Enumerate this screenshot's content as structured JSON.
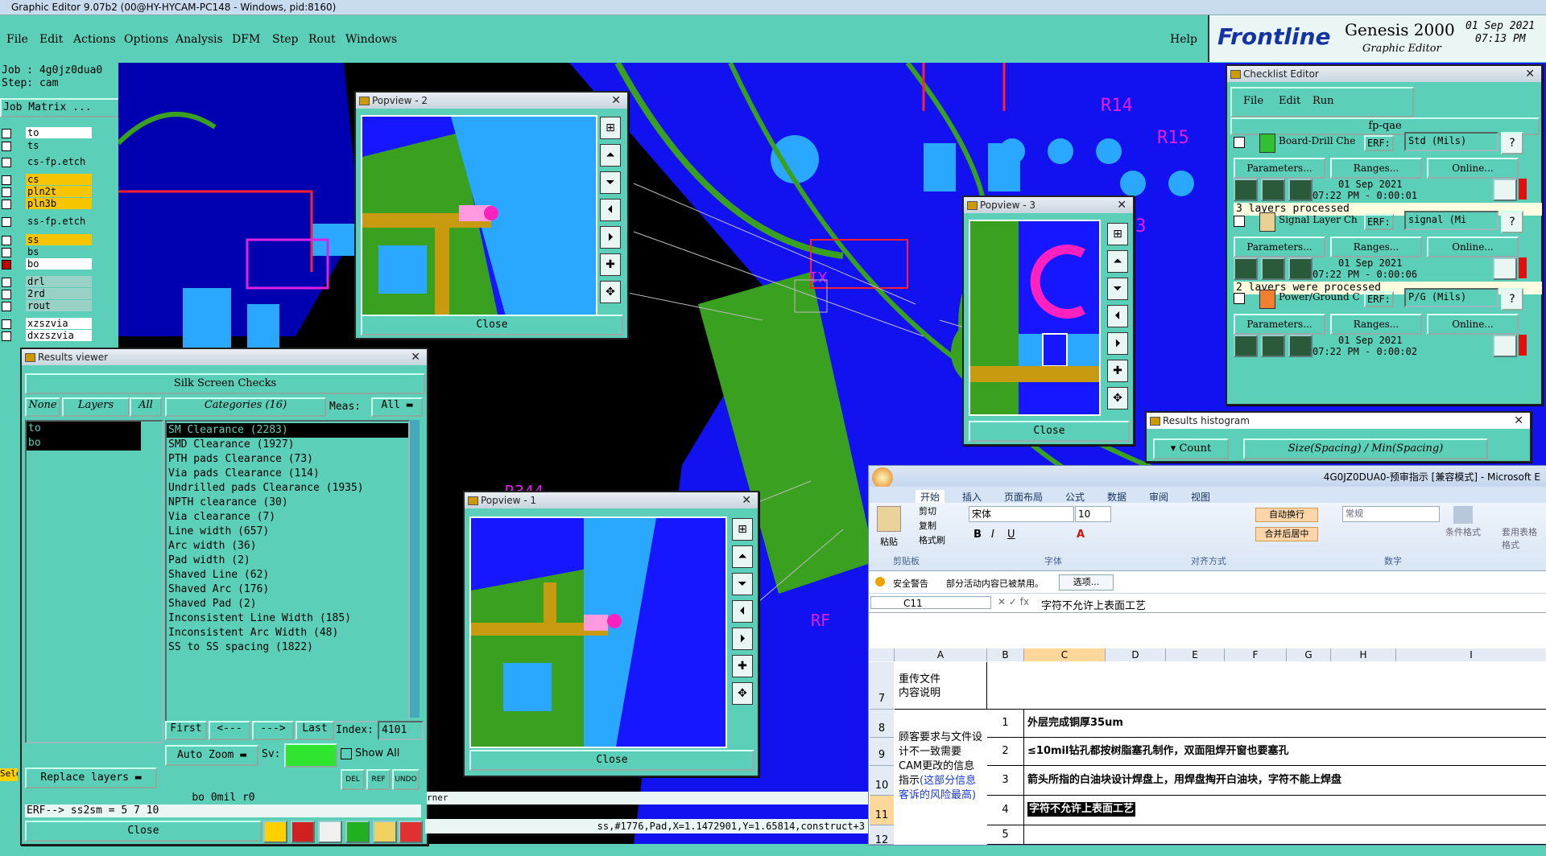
{
  "window": {
    "title": "Graphic Editor 9.07b2 (00@HY-HYCAM-PC148 - Windows, pid:8160)"
  },
  "menu": [
    "File",
    "Edit",
    "Actions",
    "Options",
    "Analysis",
    "DFM",
    "Step",
    "Rout",
    "Windows"
  ],
  "help_label": "Help",
  "brand": {
    "name": "Frontline",
    "product": "Genesis 2000",
    "subtitle": "Graphic Editor",
    "date": "01 Sep 2021",
    "time": "07:13 PM"
  },
  "job": {
    "job_label": "Job : 4g0jz0dua0",
    "step_label": "Step: cam",
    "matrix_button": "Job Matrix ..."
  },
  "layers": [
    {
      "name": "to",
      "color": "#ffffff"
    },
    {
      "name": "ts",
      "color": "#5ccfb8"
    },
    {
      "name": "cs-fp.etch",
      "color": "#5ccfb8"
    },
    {
      "name": "cs",
      "color": "#f7c400"
    },
    {
      "name": "pln2t",
      "color": "#f7c400"
    },
    {
      "name": "pln3b",
      "color": "#f7c400"
    },
    {
      "name": "ss-fp.etch",
      "color": "#5ccfb8"
    },
    {
      "name": "ss",
      "color": "#f7c400"
    },
    {
      "name": "bs",
      "color": "#5ccfb8"
    },
    {
      "name": "bo",
      "color": "#ffffff"
    },
    {
      "name": "drl",
      "color": "#9ad1c6"
    },
    {
      "name": "2rd",
      "color": "#9ad1c6"
    },
    {
      "name": "rout",
      "color": "#9ad1c6"
    },
    {
      "name": "xzszvia",
      "color": "#ffffff"
    },
    {
      "name": "dxzszvia",
      "color": "#ffffff"
    }
  ],
  "popview1": {
    "title": "Popview - 1",
    "close": "Close"
  },
  "popview2": {
    "title": "Popview - 2",
    "close": "Close"
  },
  "popview3": {
    "title": "Popview - 3",
    "close": "Close"
  },
  "results": {
    "title": "Results viewer",
    "heading": "Silk Screen Checks",
    "none_btn": "None",
    "layers_btn": "Layers",
    "all_btn": "All",
    "categories_label": "Categories (16)",
    "meas_label": "Meas:",
    "meas_value": "All",
    "layer_list": [
      "to",
      "bo"
    ],
    "categories": [
      "SM Clearance (2283)",
      "SMD Clearance (1927)",
      "PTH pads Clearance (73)",
      "Via pads Clearance (114)",
      "Undrilled pads Clearance (1935)",
      "NPTH clearance (30)",
      "Via clearance (7)",
      "Line width (657)",
      "Arc width (36)",
      "Pad width (2)",
      "Shaved Line (62)",
      "Shaved Arc (176)",
      "Shaved Pad (2)",
      "Inconsistent Line Width (185)",
      "Inconsistent Arc Width (48)",
      "SS to SS spacing (1822)"
    ],
    "first": "First",
    "prev": "<---",
    "next": "--->",
    "last": "Last",
    "index_label": "Index:",
    "index_value": "4101",
    "auto_zoom": "Auto Zoom",
    "sv_label": "Sv:",
    "show_all": "Show All",
    "replace_layers": "Replace layers",
    "status_line": "bo 0mil r0",
    "erf_line": "ERF--> ss2sm = 5 7 10",
    "close": "Close",
    "del": "DEL",
    "ref": "REF",
    "undo": "UNDO"
  },
  "checklist": {
    "title": "Checklist Editor",
    "menu": [
      "File",
      "Edit",
      "Run"
    ],
    "name": "fp-qae",
    "items": [
      {
        "label": "Board-Drill Che",
        "erf_label": "ERF:",
        "erf": "Std (Mils)",
        "params": "Parameters...",
        "ranges": "Ranges...",
        "online": "Online...",
        "date": "01 Sep 2021",
        "time": "07:22 PM - 0:00:01",
        "msg": "3 layers processed"
      },
      {
        "label": "Signal Layer Ch",
        "erf_label": "ERF:",
        "erf": "signal (Mi",
        "params": "Parameters...",
        "ranges": "Ranges...",
        "online": "Online...",
        "date": "01 Sep 2021",
        "time": "07:22 PM - 0:00:06",
        "msg": "2 layers were processed"
      },
      {
        "label": "Power/Ground C",
        "erf_label": "ERF:",
        "erf": "P/G (Mils)",
        "params": "Parameters...",
        "ranges": "Ranges...",
        "online": "Online...",
        "date": "01 Sep 2021",
        "time": "07:22 PM - 0:00:02",
        "msg": ""
      }
    ]
  },
  "histogram": {
    "title": "Results histogram",
    "count": "Count",
    "axis": "Size(Spacing) / Min(Spacing)"
  },
  "excel": {
    "title": "4G0JZ0DUA0-预审指示 [兼容模式] - Microsoft E",
    "tabs": [
      "开始",
      "插入",
      "页面布局",
      "公式",
      "数据",
      "审阅",
      "视图"
    ],
    "clipboard": {
      "paste": "粘贴",
      "cut": "剪切",
      "copy": "复制",
      "format": "格式刷",
      "group": "剪贴板"
    },
    "font": {
      "name": "宋体",
      "size": "10",
      "group": "字体"
    },
    "align": {
      "wrap": "自动换行",
      "merge": "合并后居中",
      "group": "对齐方式"
    },
    "number": {
      "format": "常规",
      "group": "数字"
    },
    "styles": {
      "cond": "条件格式",
      "table": "套用表格格式"
    },
    "security": {
      "label": "安全警告",
      "msg": "部分活动内容已被禁用。",
      "options": "选项..."
    },
    "namebox": "C11",
    "formula": "字符不允许上表面工艺",
    "columns": [
      "A",
      "B",
      "C",
      "D",
      "E",
      "F",
      "G",
      "H",
      "I"
    ],
    "row_numbers": [
      "7",
      "8",
      "9",
      "10",
      "11",
      "12"
    ],
    "cells": {
      "a7": "重传文件\n内容说明",
      "a8_black": "顾客要求与文件设计不一致需要CAM更改的信息指示",
      "a8_blue": "(这部分信息客诉的风险最高)",
      "rows": [
        {
          "num": "1",
          "text": "外层完成铜厚35um"
        },
        {
          "num": "2",
          "text": "≤10mil钻孔都按树脂塞孔制作，双面阻焊开窗也要塞孔"
        },
        {
          "num": "3",
          "text": "箭头所指的白油块设计焊盘上，用焊盘掏开白油块，字符不能上焊盘"
        },
        {
          "num": "4",
          "text": "字符不允许上表面工艺"
        },
        {
          "num": "5",
          "text": ""
        }
      ]
    }
  },
  "status_bar": "ss,#1776,Pad,X=1.1472901,Y=1.65814,construct+3",
  "corner_text": "rner",
  "side_text": "Sele"
}
